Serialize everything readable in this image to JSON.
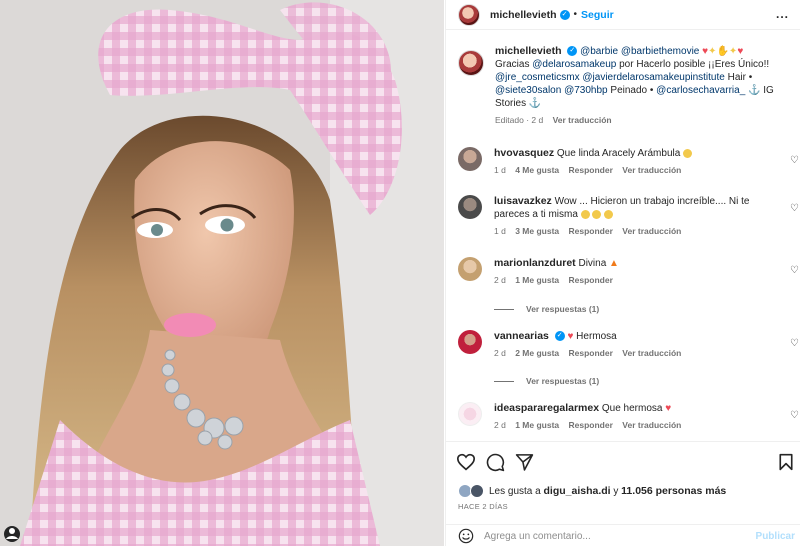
{
  "post": {
    "author": "michellevieth",
    "follow_label": "Seguir",
    "more_label": "..."
  },
  "caption": {
    "username": "michellevieth",
    "line1_mentions": [
      "@barbie",
      "@barbiethemovie"
    ],
    "line2_text": "Gracias",
    "line2_mention": "@delarosamakeup",
    "line2_rest": "por Hacerlo posible ¡¡Eres Único!!",
    "line3_mentions": [
      "@jre_cosmeticsmx",
      "@javierdelarosamakeupinstitute"
    ],
    "line3_rest": "Hair •",
    "line4_mentions": [
      "@siete30salon",
      "@730hbp"
    ],
    "line4_text": "Peinado •",
    "line4_mention2": "@carlosechavarria_",
    "line4_rest": "IG",
    "line5_text": "Stories",
    "edited": "Editado · 2 d",
    "translate": "Ver traducción"
  },
  "comments": [
    {
      "user": "hvovasquez",
      "text": "Que linda Aracely Arámbula",
      "age": "1 d",
      "likes": "4 Me gusta",
      "reply": "Responder",
      "translate": "Ver traducción"
    },
    {
      "user": "luisavazkez",
      "text": "Wow ... Hicieron un trabajo increíble.... Ni te pareces a ti misma",
      "age": "1 d",
      "likes": "3 Me gusta",
      "reply": "Responder",
      "translate": "Ver traducción"
    },
    {
      "user": "marionlanzduret",
      "text": "Divina",
      "age": "2 d",
      "likes": "1 Me gusta",
      "reply": "Responder",
      "replies": "Ver respuestas (1)"
    },
    {
      "user": "vannearias",
      "text": "Hermosa",
      "age": "2 d",
      "likes": "2 Me gusta",
      "reply": "Responder",
      "translate": "Ver traducción",
      "replies": "Ver respuestas (1)"
    },
    {
      "user": "ideaspararegalarmex",
      "text": "Que hermosa",
      "age": "2 d",
      "likes": "1 Me gusta",
      "reply": "Responder",
      "translate": "Ver traducción"
    }
  ],
  "likes": {
    "prefix": "Les gusta a",
    "user": "digu_aisha.di",
    "joiner": "y",
    "count": "11.056 personas más"
  },
  "time_ago": "HACE 2 DÍAS",
  "add_comment": {
    "placeholder": "Agrega un comentario...",
    "publish": "Publicar"
  },
  "colors": {
    "accent": "#0095f6",
    "mention": "#00376b",
    "heart": "#ed4956",
    "muted": "#737373"
  }
}
